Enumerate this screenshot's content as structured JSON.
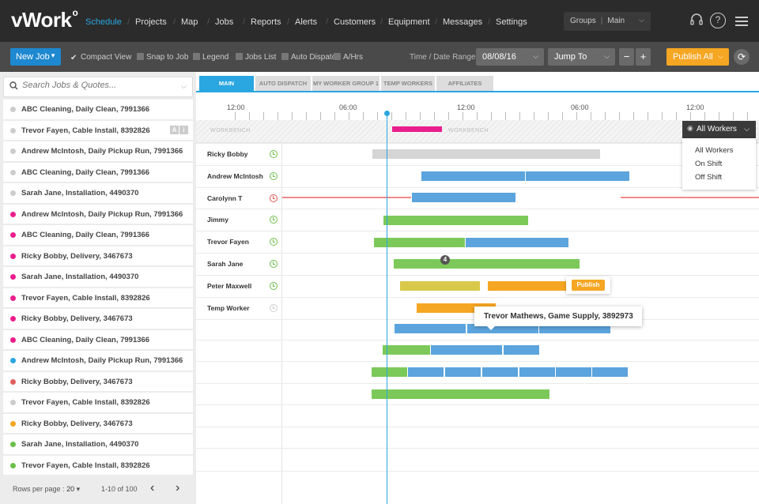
{
  "app": {
    "logo": "vWork"
  },
  "nav": {
    "items": [
      "Schedule",
      "Projects",
      "Map",
      "Jobs",
      "Reports",
      "Alerts",
      "Customers",
      "Equipment",
      "Messages",
      "Settings"
    ],
    "active": "Schedule",
    "groups_label": "Groups",
    "groups_value": "Main"
  },
  "toolbar": {
    "new_job": "New Job",
    "options": [
      {
        "label": "Compact View",
        "checked": true
      },
      {
        "label": "Snap to Job",
        "checked": false
      },
      {
        "label": "Legend",
        "checked": false
      },
      {
        "label": "Jobs List",
        "checked": false
      },
      {
        "label": "Auto Dispatch",
        "checked": false
      },
      {
        "label": "A/Hrs",
        "checked": false
      }
    ],
    "time_range_label": "Time / Date Range",
    "date": "08/08/16",
    "jump_to": "Jump To",
    "zoom_out": "−",
    "zoom_in": "+",
    "publish_all": "Publish All"
  },
  "search": {
    "placeholder": "Search Jobs & Quotes..."
  },
  "jobs": [
    {
      "label": "ABC Cleaning, Daily Clean, 7991366",
      "color": "#cccccc"
    },
    {
      "label": "Trevor Fayen, Cable Install, 8392826",
      "color": "#cccccc",
      "tags": [
        "A",
        "i"
      ]
    },
    {
      "label": "Andrew McIntosh, Daily Pickup Run, 7991366",
      "color": "#cccccc"
    },
    {
      "label": "ABC Cleaning, Daily Clean, 7991366",
      "color": "#cccccc"
    },
    {
      "label": "Sarah Jane, Installation, 4490370",
      "color": "#cccccc"
    },
    {
      "label": "Andrew McIntosh, Daily Pickup Run, 7991366",
      "color": "#e91e8c"
    },
    {
      "label": "ABC Cleaning, Daily Clean, 7991366",
      "color": "#e91e8c"
    },
    {
      "label": "Ricky Bobby, Delivery, 3467673",
      "color": "#e91e8c"
    },
    {
      "label": "Sarah Jane, Installation, 4490370",
      "color": "#e91e8c"
    },
    {
      "label": "Trevor Fayen, Cable Install, 8392826",
      "color": "#e91e8c"
    },
    {
      "label": "Ricky Bobby, Delivery, 3467673",
      "color": "#e91e8c"
    },
    {
      "label": "ABC Cleaning, Daily Clean, 7991366",
      "color": "#e91e8c"
    },
    {
      "label": "Andrew McIntosh, Daily Pickup Run, 7991366",
      "color": "#2aa6e0"
    },
    {
      "label": "Ricky Bobby, Delivery, 3467673",
      "color": "#e06060"
    },
    {
      "label": "Trevor Fayen, Cable Install, 8392826",
      "color": "#cccccc"
    },
    {
      "label": "Ricky Bobby, Delivery, 3467673",
      "color": "#f5a623"
    },
    {
      "label": "Sarah Jane, Installation, 4490370",
      "color": "#6cc04a"
    },
    {
      "label": "Trevor Fayen, Cable Install, 8392826",
      "color": "#6cc04a"
    }
  ],
  "pager": {
    "rows_per_page_label": "Rows per page :",
    "rows_per_page": "20",
    "range": "1-10 of 100"
  },
  "tabs": [
    "MAIN",
    "AUTO DISPATCH",
    "MY WORKER GROUP 1",
    "TEMP WORKERS",
    "AFFILIATES"
  ],
  "timeline": {
    "ticks": [
      "12:00",
      "06:00",
      "12:00",
      "06:00",
      "12:00"
    ],
    "bench_label": "WORKBENCH"
  },
  "workers": [
    {
      "name": "Ricky Bobby",
      "status": "on"
    },
    {
      "name": "Andrew McIntosh",
      "status": "on"
    },
    {
      "name": "Carolynn T",
      "status": "late"
    },
    {
      "name": "Jimmy",
      "status": "on"
    },
    {
      "name": "Trevor Fayen",
      "status": "on"
    },
    {
      "name": "Sarah Jane",
      "status": "on"
    },
    {
      "name": "Peter Maxwell",
      "status": "on"
    },
    {
      "name": "Temp Worker",
      "status": "off"
    }
  ],
  "overlap_badge": "4",
  "publish_popup": "Publish",
  "tooltip": "Trevor Mathews, Game Supply, 3892973",
  "filter": {
    "selected": "All Workers",
    "options": [
      "All Workers",
      "On Shift",
      "Off Shift"
    ]
  },
  "colors": {
    "blue": "#5ba4dd",
    "green": "#7cc95a",
    "pink": "#e91e8c",
    "orange": "#f5a623",
    "yellow": "#d9c94a",
    "grey": "#d5d5d5",
    "red": "#f08a8a"
  }
}
